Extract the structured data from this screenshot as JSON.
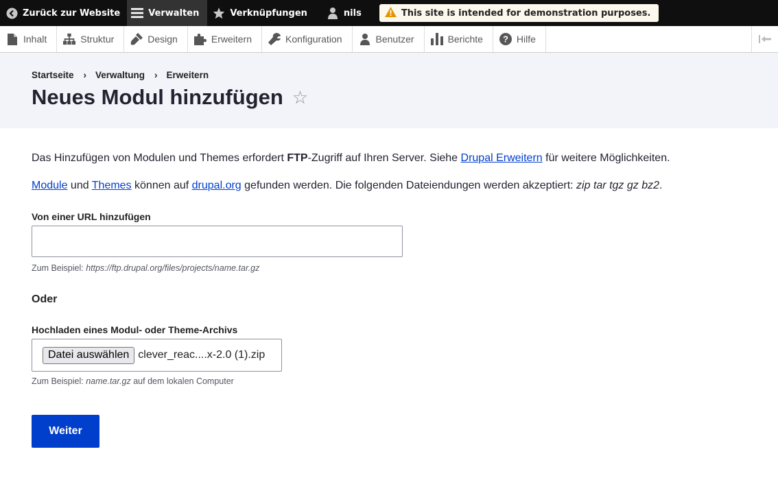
{
  "toolbar": {
    "back_label": "Zurück zur Website",
    "manage_label": "Verwalten",
    "shortcuts_label": "Verknüpfungen",
    "user_label": "nils",
    "notice": "This site is intended for demonstration purposes."
  },
  "tray": {
    "items": [
      {
        "label": "Inhalt",
        "icon": "file-icon"
      },
      {
        "label": "Struktur",
        "icon": "sitemap-icon"
      },
      {
        "label": "Design",
        "icon": "paintbrush-icon"
      },
      {
        "label": "Erweitern",
        "icon": "puzzle-icon"
      },
      {
        "label": "Konfiguration",
        "icon": "wrench-icon"
      },
      {
        "label": "Benutzer",
        "icon": "people-icon"
      },
      {
        "label": "Berichte",
        "icon": "bar-chart-icon"
      },
      {
        "label": "Hilfe",
        "icon": "help-icon"
      }
    ]
  },
  "breadcrumb": [
    "Startseite",
    "Verwaltung",
    "Erweitern"
  ],
  "page_title": "Neues Modul hinzufügen",
  "intro": {
    "p1_before": "Das Hinzufügen von Modulen und Themes erfordert ",
    "p1_bold": "FTP",
    "p1_middle": "-Zugriff auf Ihren Server. Siehe ",
    "p1_link": "Drupal Erweitern",
    "p1_after": " für weitere Möglichkeiten.",
    "p2_link_modules": "Module",
    "p2_and": " und ",
    "p2_link_themes": "Themes",
    "p2_middle": " können auf ",
    "p2_link_drupal": "drupal.org",
    "p2_after": " gefunden werden. Die folgenden Dateiendungen werden akzeptiert: ",
    "p2_extensions": "zip tar tgz gz bz2",
    "p2_end": "."
  },
  "url_field": {
    "label": "Von einer URL hinzufügen",
    "value": "",
    "desc_prefix": "Zum Beispiel: ",
    "desc_example": "https://ftp.drupal.org/files/projects/name.tar.gz"
  },
  "or_label": "Oder",
  "upload_field": {
    "label": "Hochladen eines Modul- oder Theme-Archivs",
    "button_label": "Datei auswählen",
    "file_name": "clever_reac....x-2.0 (1).zip",
    "desc_prefix": "Zum Beispiel: ",
    "desc_example": "name.tar.gz",
    "desc_suffix": " auf dem lokalen Computer"
  },
  "submit_label": "Weiter",
  "colors": {
    "toolbar_bg": "#0f0f0f",
    "primary": "#003ecc",
    "header_bg": "#f3f4f9",
    "warning": "#e29700"
  }
}
